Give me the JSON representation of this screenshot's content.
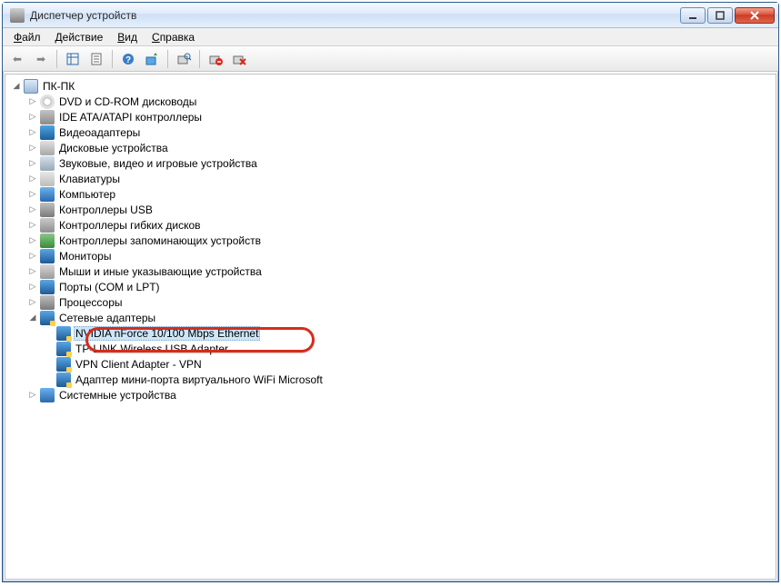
{
  "window": {
    "title": "Диспетчер устройств"
  },
  "menu": {
    "file": {
      "label": "Файл",
      "hotkey_index": 0
    },
    "action": {
      "label": "Действие",
      "hotkey_index": 0
    },
    "view": {
      "label": "Вид",
      "hotkey_index": 0
    },
    "help": {
      "label": "Справка",
      "hotkey_index": 0
    }
  },
  "toolbar": {
    "back": {
      "name": "back",
      "enabled": false
    },
    "forward": {
      "name": "forward",
      "enabled": false
    },
    "show_hide": {
      "name": "show-hide-tree",
      "enabled": true
    },
    "properties": {
      "name": "properties",
      "enabled": true
    },
    "help": {
      "name": "help",
      "enabled": true
    },
    "update": {
      "name": "update-driver",
      "enabled": true
    },
    "scan": {
      "name": "scan-hardware",
      "enabled": true
    },
    "uninstall": {
      "name": "uninstall",
      "enabled": true
    },
    "disable": {
      "name": "disable",
      "enabled": true
    }
  },
  "tree": {
    "root": {
      "label": "ПК-ПК",
      "expanded": true
    },
    "categories": [
      {
        "id": "dvd",
        "label": "DVD и CD-ROM дисководы",
        "expanded": false,
        "icon": "ic-disc"
      },
      {
        "id": "ide",
        "label": "IDE ATA/ATAPI контроллеры",
        "expanded": false,
        "icon": "ic-ide"
      },
      {
        "id": "video",
        "label": "Видеоадаптеры",
        "expanded": false,
        "icon": "ic-video"
      },
      {
        "id": "disk",
        "label": "Дисковые устройства",
        "expanded": false,
        "icon": "ic-drive"
      },
      {
        "id": "sound",
        "label": "Звуковые, видео и игровые устройства",
        "expanded": false,
        "icon": "ic-sound"
      },
      {
        "id": "keyboard",
        "label": "Клавиатуры",
        "expanded": false,
        "icon": "ic-kbd"
      },
      {
        "id": "computer",
        "label": "Компьютер",
        "expanded": false,
        "icon": "ic-comp"
      },
      {
        "id": "usb",
        "label": "Контроллеры USB",
        "expanded": false,
        "icon": "ic-usb"
      },
      {
        "id": "floppy",
        "label": "Контроллеры гибких дисков",
        "expanded": false,
        "icon": "ic-floppy"
      },
      {
        "id": "pnp",
        "label": "Контроллеры запоминающих устройств",
        "expanded": false,
        "icon": "ic-pnp"
      },
      {
        "id": "monitor",
        "label": "Мониторы",
        "expanded": false,
        "icon": "ic-mon"
      },
      {
        "id": "mouse",
        "label": "Мыши и иные указывающие устройства",
        "expanded": false,
        "icon": "ic-mouse"
      },
      {
        "id": "ports",
        "label": "Порты (COM и LPT)",
        "expanded": false,
        "icon": "ic-port"
      },
      {
        "id": "cpu",
        "label": "Процессоры",
        "expanded": false,
        "icon": "ic-cpu"
      },
      {
        "id": "net",
        "label": "Сетевые адаптеры",
        "expanded": true,
        "icon": "ic-net",
        "children": [
          {
            "id": "net-nvidia",
            "label": "NVIDIA nForce 10/100 Mbps Ethernet",
            "selected": true
          },
          {
            "id": "net-tplink",
            "label": "TP-LINK Wireless USB Adapter",
            "selected": false
          },
          {
            "id": "net-vpn",
            "label": "VPN Client Adapter - VPN",
            "selected": false
          },
          {
            "id": "net-msvwifi",
            "label": "Адаптер мини-порта виртуального WiFi Microsoft",
            "selected": false
          }
        ]
      },
      {
        "id": "system",
        "label": "Системные устройства",
        "expanded": false,
        "icon": "ic-sys"
      }
    ]
  }
}
